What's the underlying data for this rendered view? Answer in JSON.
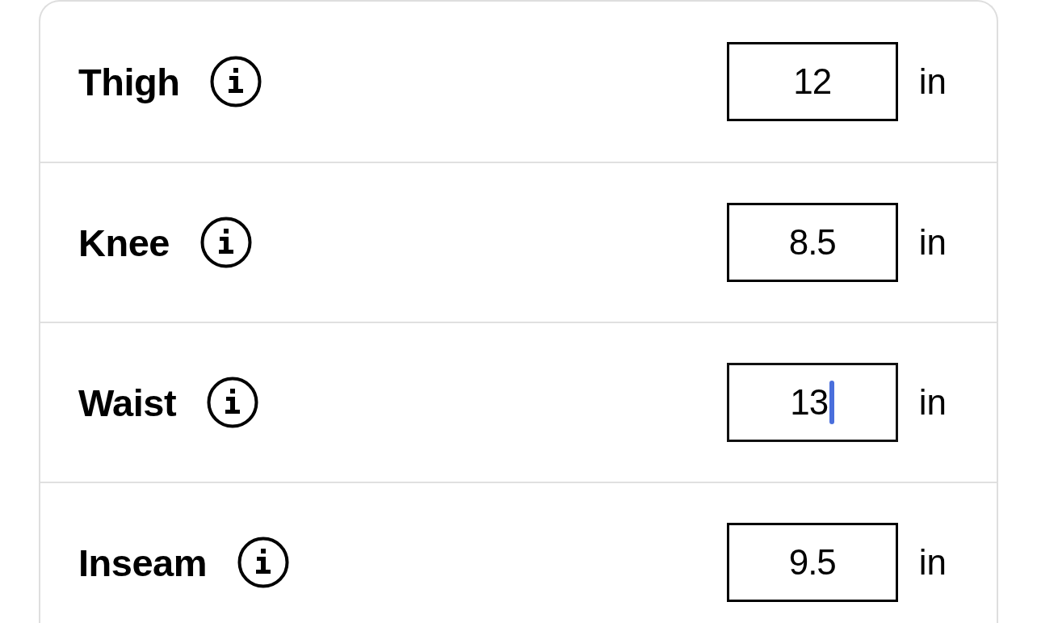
{
  "rows": [
    {
      "label": "Thigh",
      "value": "12",
      "unit": "in",
      "focused": false
    },
    {
      "label": "Knee",
      "value": "8.5",
      "unit": "in",
      "focused": false
    },
    {
      "label": "Waist",
      "value": "13",
      "unit": "in",
      "focused": true
    },
    {
      "label": "Inseam",
      "value": "9.5",
      "unit": "in",
      "focused": false
    }
  ]
}
